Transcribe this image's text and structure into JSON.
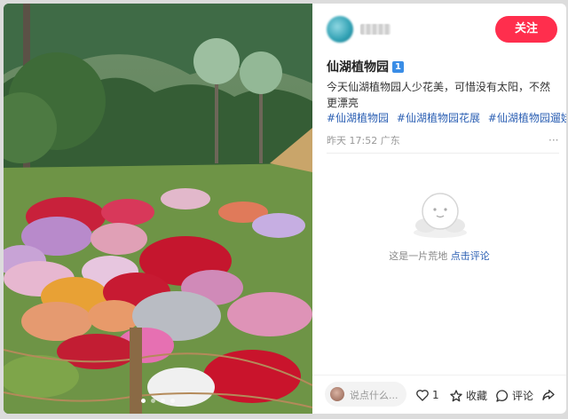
{
  "author": {
    "name": "ＸＸ",
    "follow_label": "关注"
  },
  "note": {
    "title": "仙湖植物园",
    "badge": "1",
    "description": "今天仙湖植物园人少花美，可惜没有太阳，不然更漂亮",
    "tags": [
      "#仙湖植物园",
      "#仙湖植物园花展",
      "#仙湖植物园遛娃"
    ],
    "time": "昨天 17:52",
    "location": "广东",
    "more": "···"
  },
  "comments_empty": {
    "text": "这是一片荒地",
    "link": "点击评论"
  },
  "bottom_bar": {
    "comment_placeholder": "说点什么...",
    "like_count": "1",
    "collect_label": "收藏",
    "comment_label": "评论"
  },
  "colors": {
    "accent": "#ff2e4d",
    "tag": "#2b5fb3",
    "badge": "#3a8de6"
  },
  "icons": [
    "heart-icon",
    "star-icon",
    "comment-icon",
    "share-icon",
    "empty-cloud-icon"
  ]
}
